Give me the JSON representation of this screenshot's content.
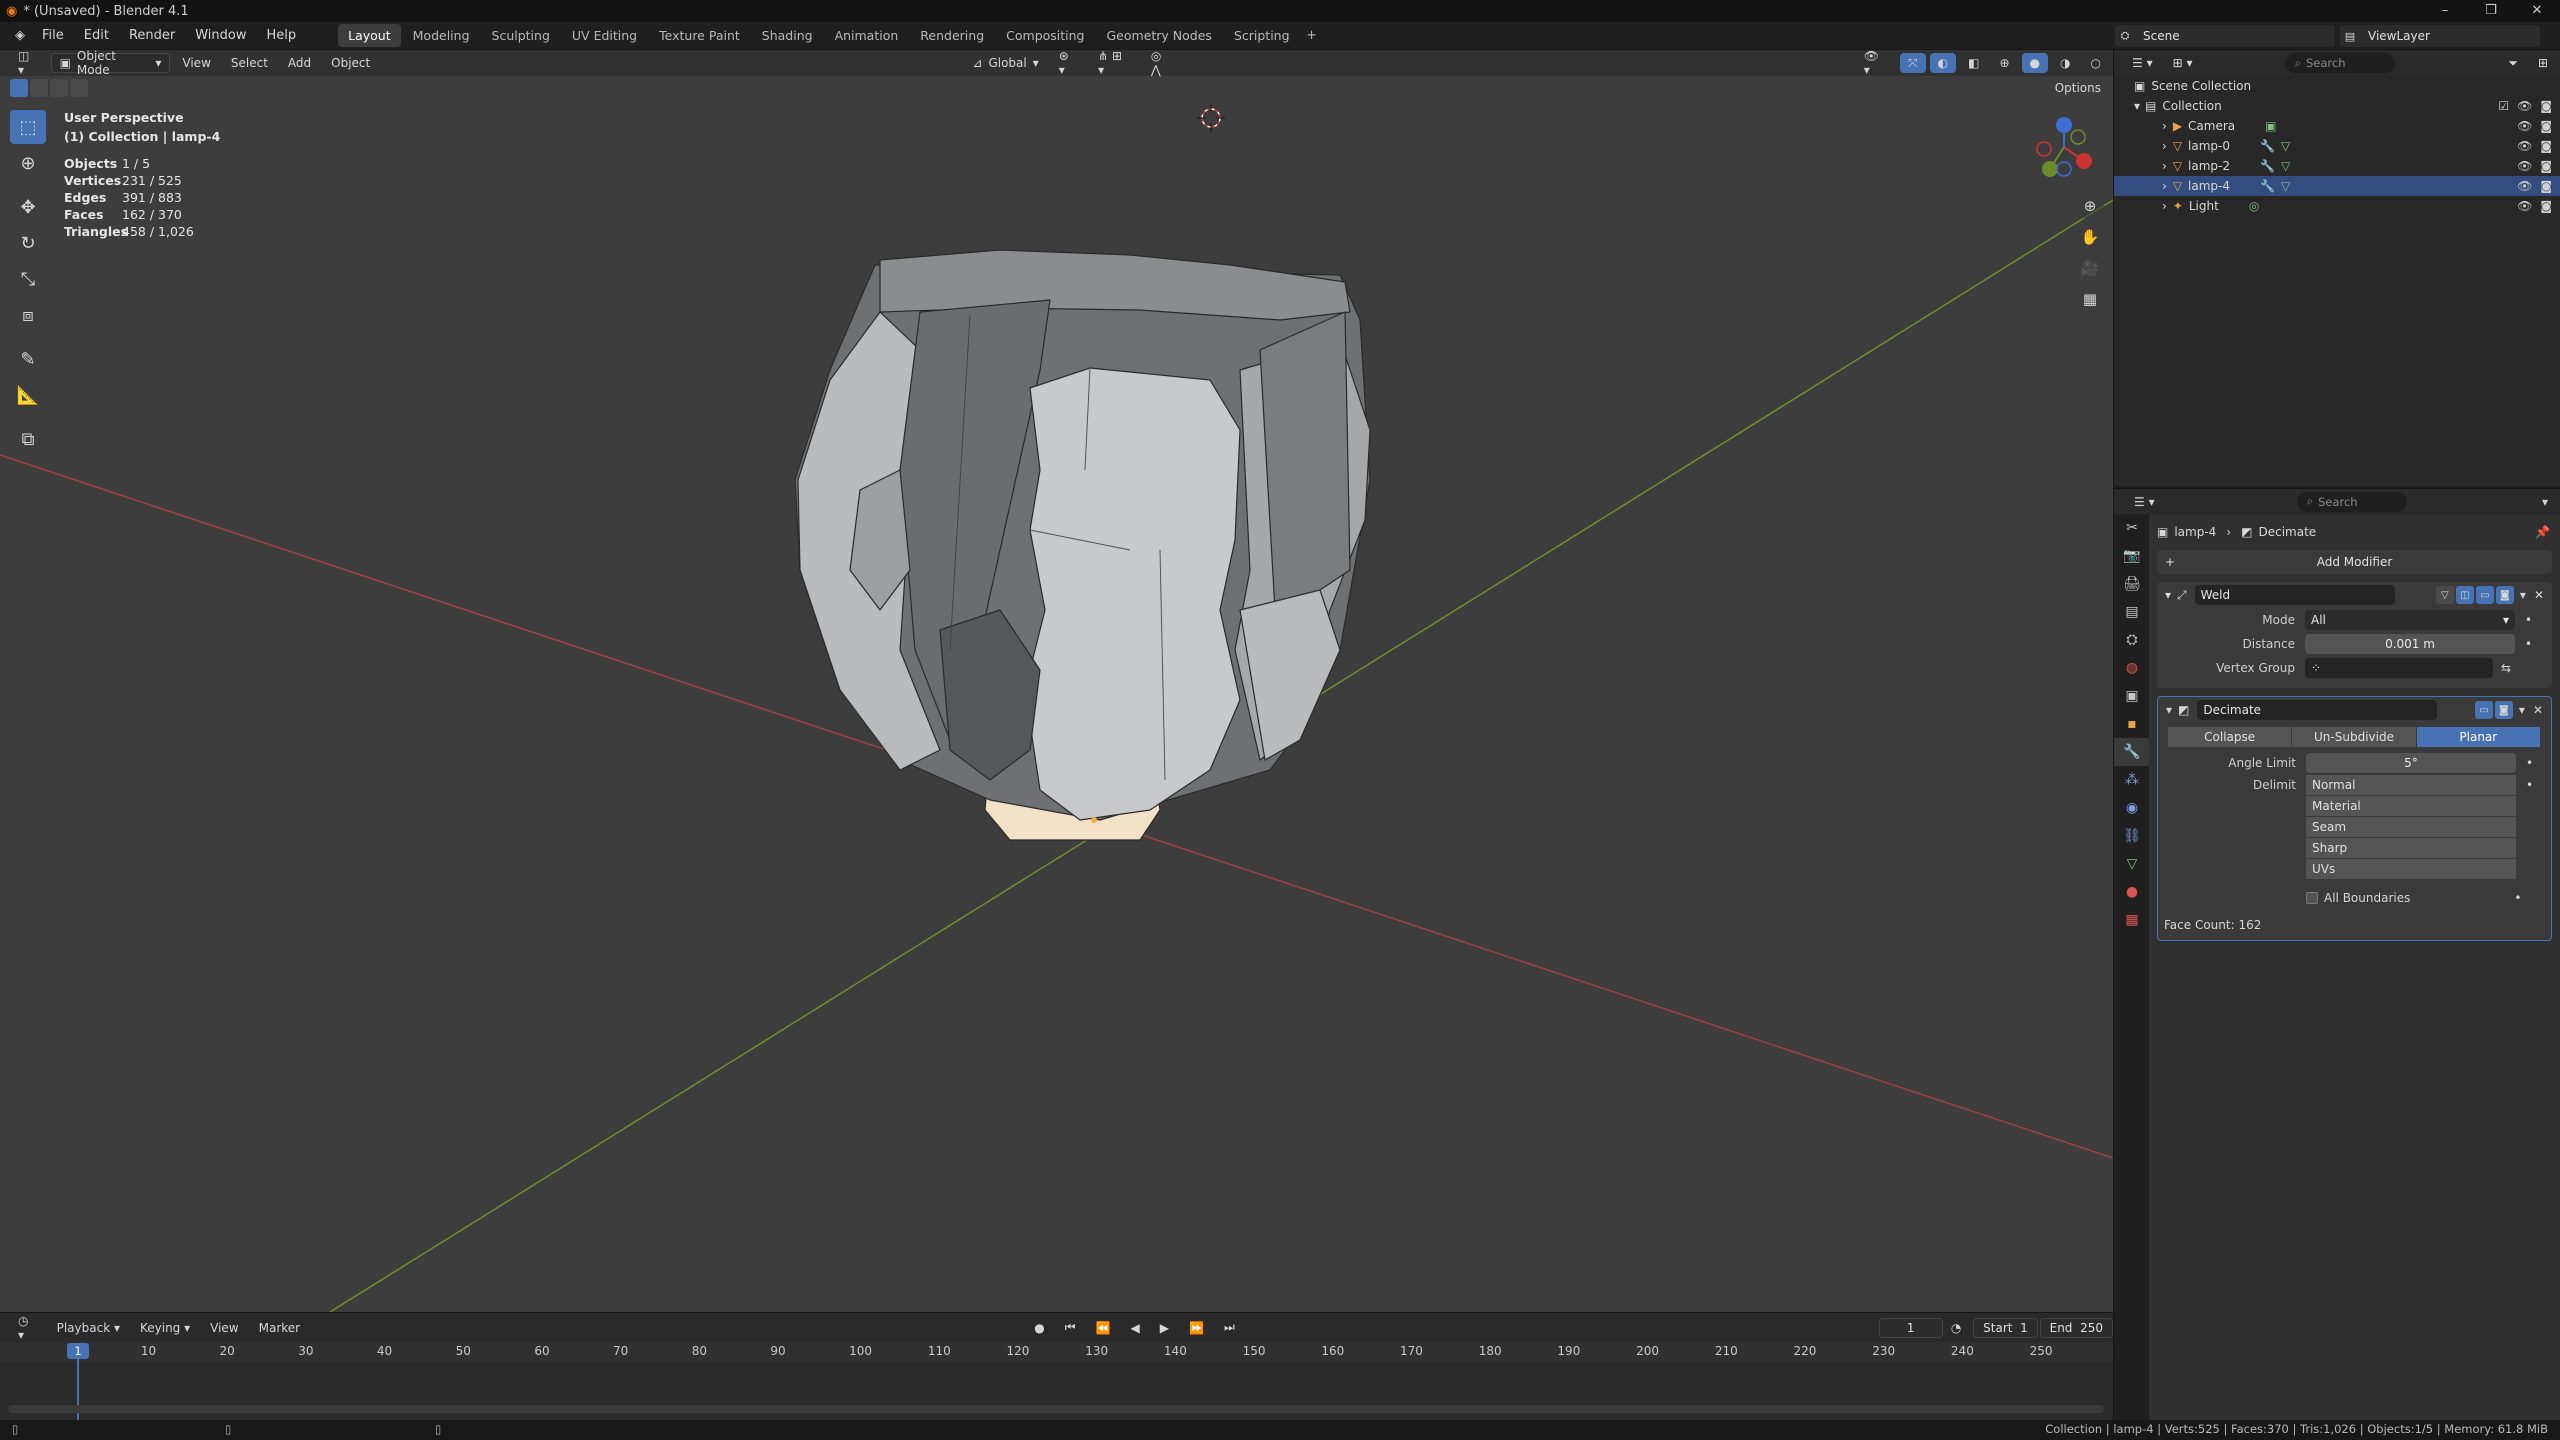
{
  "window": {
    "title": "* (Unsaved) - Blender 4.1",
    "min": "–",
    "max": "❐",
    "close": "✕"
  },
  "menubar": {
    "menus": [
      "File",
      "Edit",
      "Render",
      "Window",
      "Help"
    ],
    "workspaces": [
      "Layout",
      "Modeling",
      "Sculpting",
      "UV Editing",
      "Texture Paint",
      "Shading",
      "Animation",
      "Rendering",
      "Compositing",
      "Geometry Nodes",
      "Scripting"
    ],
    "active_workspace": "Layout",
    "add_tab": "+",
    "scene": "Scene",
    "view_layer": "ViewLayer"
  },
  "viewport_header": {
    "mode": "Object Mode",
    "menus": [
      "View",
      "Select",
      "Add",
      "Object"
    ],
    "transform_orientation": "Global",
    "options": "Options"
  },
  "overlay": {
    "title": "User Perspective",
    "subtitle": "(1) Collection | lamp-4",
    "stats": [
      {
        "key": "Objects",
        "value": "1 / 5"
      },
      {
        "key": "Vertices",
        "value": "231 / 525"
      },
      {
        "key": "Edges",
        "value": "391 / 883"
      },
      {
        "key": "Faces",
        "value": "162 / 370"
      },
      {
        "key": "Triangles",
        "value": "458 / 1,026"
      }
    ]
  },
  "timeline": {
    "menus": [
      "Playback",
      "Keying",
      "View",
      "Marker"
    ],
    "current_frame": "1",
    "start_label": "Start",
    "start": "1",
    "end_label": "End",
    "end": "250",
    "ruler": [
      "10",
      "20",
      "30",
      "40",
      "50",
      "60",
      "70",
      "80",
      "90",
      "100",
      "110",
      "120",
      "130",
      "140",
      "150",
      "160",
      "170",
      "180",
      "190",
      "200",
      "210",
      "220",
      "230",
      "240",
      "250"
    ],
    "ruler_cursor": "1"
  },
  "outliner": {
    "search_placeholder": "Search",
    "root": "Scene Collection",
    "collection": "Collection",
    "items": [
      {
        "name": "Camera",
        "selected": false
      },
      {
        "name": "lamp-0",
        "selected": false
      },
      {
        "name": "lamp-2",
        "selected": false
      },
      {
        "name": "lamp-4",
        "selected": true
      },
      {
        "name": "Light",
        "selected": false
      }
    ]
  },
  "properties": {
    "search_placeholder": "Search",
    "breadcrumb_object": "lamp-4",
    "breadcrumb_modifier": "Decimate",
    "add_modifier": "Add Modifier",
    "weld": {
      "name": "Weld",
      "mode_label": "Mode",
      "mode": "All",
      "distance_label": "Distance",
      "distance": "0.001 m",
      "vertex_group_label": "Vertex Group"
    },
    "decimate": {
      "name": "Decimate",
      "modes": [
        "Collapse",
        "Un-Subdivide",
        "Planar"
      ],
      "active_mode": "Planar",
      "angle_label": "Angle Limit",
      "angle": "5°",
      "delimit_label": "Delimit",
      "delimit": [
        "Normal",
        "Material",
        "Seam",
        "Sharp",
        "UVs"
      ],
      "all_boundaries": "All Boundaries",
      "face_count": "Face Count: 162"
    }
  },
  "statusbar": {
    "info": "Collection | lamp-4 | Verts:525 | Faces:370 | Tris:1,026 | Objects:1/5 | Memory: 61.8 MiB"
  },
  "colors": {
    "accent": "#4772b3",
    "x_axis": "#b23b3b",
    "y_axis": "#6b8f2a"
  }
}
